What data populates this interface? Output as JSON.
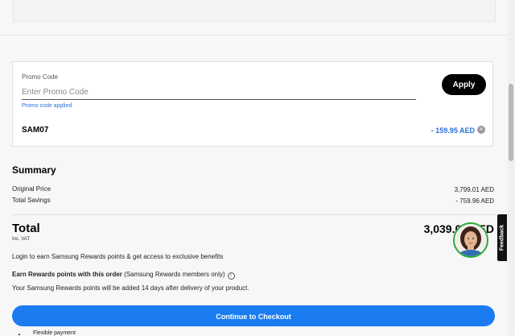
{
  "promo": {
    "label": "Promo Code",
    "placeholder": "Enter Promo Code",
    "applied_text": "Promo code applied",
    "apply_label": "Apply",
    "code": "SAM07",
    "discount": "- 159.95 AED"
  },
  "summary": {
    "title": "Summary",
    "original_price_label": "Original Price",
    "original_price_value": "3,799.01 AED",
    "total_savings_label": "Total Savings",
    "total_savings_value": "- 759.96 AED",
    "total_label": "Total",
    "inc_vat": "Inc. VAT",
    "total_value": "3,039.05 AED"
  },
  "rewards": {
    "login_text": "Login to earn Samsung Rewards points & get access to exclusive benefits",
    "earn_bold": "Earn Rewards points with this order",
    "earn_note": "(Samsung Rewards members only)",
    "points_note": "Your Samsung Rewards points will be added 14 days after delivery of your product."
  },
  "checkout": {
    "label": "Continue to Checkout"
  },
  "flexible_payment": "Flexible payment",
  "feedback": "Feedback",
  "colors": {
    "accent": "#1a7cf0",
    "link": "#2a6fd6",
    "avatar_ring": "#2aa83a"
  },
  "icons": {
    "remove": "close-circle-icon",
    "info": "info-icon",
    "avatar": "chat-assistant-avatar"
  }
}
